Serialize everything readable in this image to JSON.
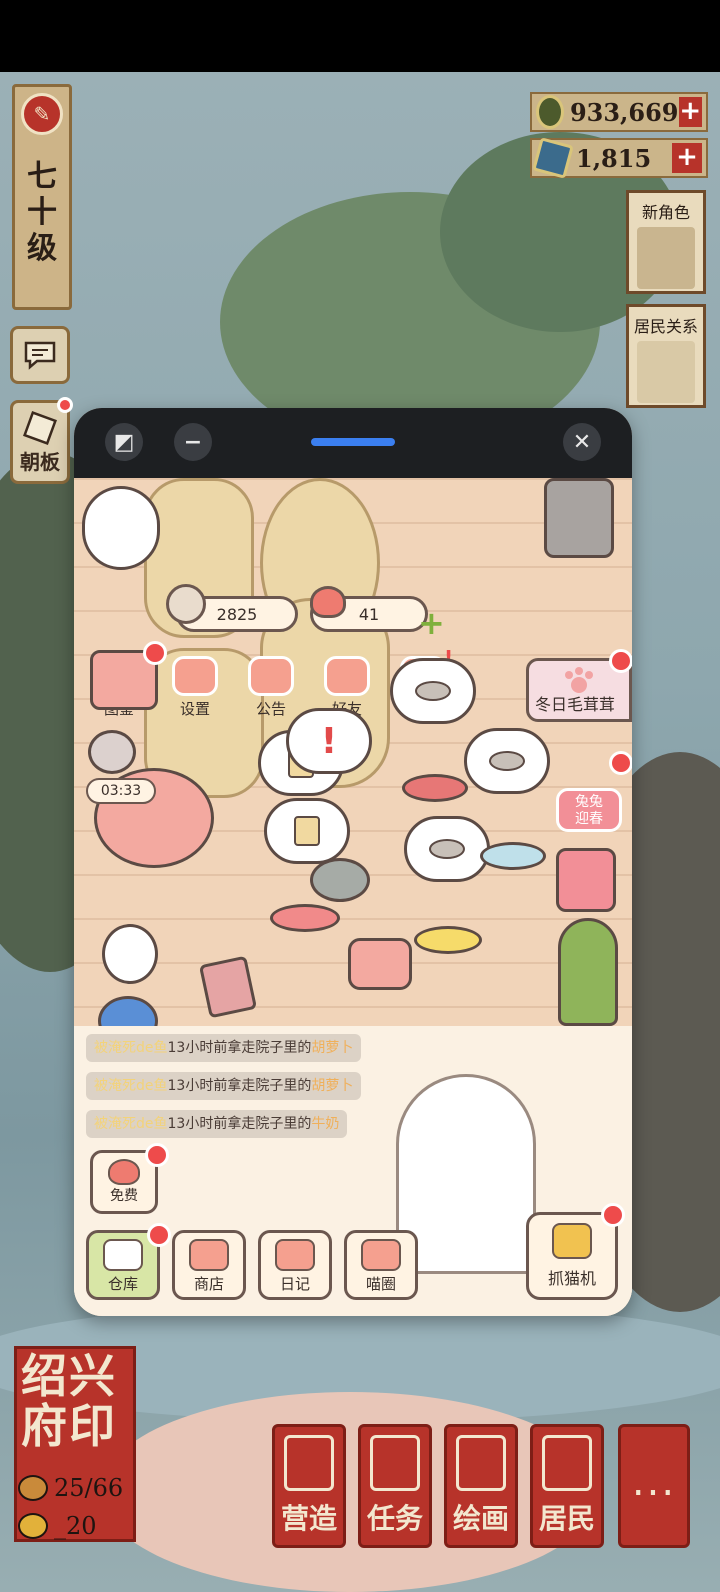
{
  "game": {
    "level_text": "七\n十\n级",
    "side": {
      "board_label": "朝板"
    },
    "currencies": {
      "coins": "933,669",
      "gems": "1,815",
      "add": "+"
    },
    "cards": {
      "new_character": "新角色",
      "relations": "居民关系"
    },
    "seal_text": "绍兴\n府印",
    "population": {
      "current": "25/66",
      "second": "_20"
    },
    "nav": [
      {
        "label": "营造",
        "icon": "building-icon"
      },
      {
        "label": "任务",
        "icon": "book-icon"
      },
      {
        "label": "绘画",
        "icon": "scroll-icon"
      },
      {
        "label": "居民",
        "icon": "resident-icon"
      }
    ],
    "more": "..."
  },
  "floating_window": {
    "close": "✕",
    "minimize": "−",
    "resize": "◩"
  },
  "cat_app": {
    "fish_count": "2825",
    "heart_count": "41",
    "plus": "+",
    "menu": [
      "图鉴",
      "设置",
      "公告",
      "好友",
      ""
    ],
    "event_label": "冬日毛茸茸",
    "timer": "03:33",
    "badge": "兔兔\n迎春",
    "messages": [
      {
        "name": "被淹死de鱼",
        "middle": "13小时前拿走院子里的",
        "item": "胡萝卜"
      },
      {
        "name": "被淹死de鱼",
        "middle": "13小时前拿走院子里的",
        "item": "胡萝卜"
      },
      {
        "name": "被淹死de鱼",
        "middle": "13小时前拿走院子里的",
        "item": "牛奶"
      }
    ],
    "free_label": "免费",
    "bottom": [
      "仓库",
      "商店",
      "日记",
      "喵圈"
    ],
    "claw_label": "抓猫机",
    "colors": {
      "accent_blue": "#3b7ff0",
      "red_dot": "#ee4b4b"
    }
  }
}
